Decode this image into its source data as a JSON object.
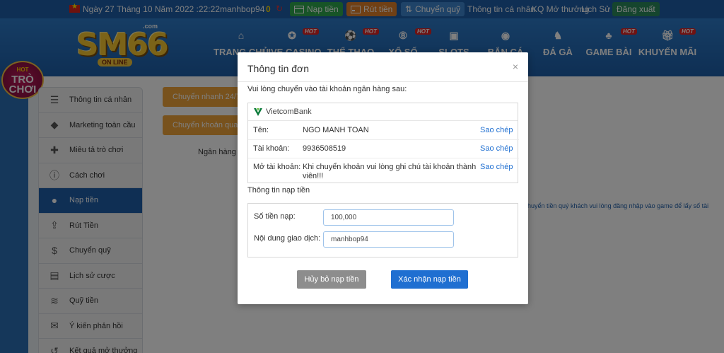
{
  "topbar": {
    "date": "Ngày 27 Tháng 10 Năm 2022 :22:22",
    "username": "manhbop94",
    "balance": "0",
    "deposit_label": "Nạp tiền",
    "withdraw_label": "Rút tiền",
    "transfer_label": "Chuyển quỹ",
    "links": [
      "Thông tin cá nhân",
      "KQ Mở thưởng",
      "Lịch Sử"
    ],
    "logout_label": "Đăng xuất"
  },
  "logo": {
    "text": "SM66",
    "com": ".com",
    "tagline": "ON LINE"
  },
  "nav": {
    "items": [
      {
        "label": "TRANG CHỦ",
        "icon": "home-icon",
        "hot": false
      },
      {
        "label": "LIVE CASINO",
        "icon": "casino-chip-icon",
        "hot": true
      },
      {
        "label": "THỂ THAO",
        "icon": "soccer-ball-icon",
        "hot": true
      },
      {
        "label": "XỔ SỐ",
        "icon": "lottery-ball-icon",
        "hot": true
      },
      {
        "label": "SLOTS",
        "icon": "slot-machine-icon",
        "hot": false
      },
      {
        "label": "BẮN CÁ",
        "icon": "fish-icon",
        "hot": false
      },
      {
        "label": "ĐÁ GÀ",
        "icon": "rooster-icon",
        "hot": false
      },
      {
        "label": "GAME BÀI",
        "icon": "cards-icon",
        "hot": true
      },
      {
        "label": "KHUYẾN MÃI",
        "icon": "gift-icon",
        "hot": true
      }
    ],
    "hot_label": "HOT"
  },
  "promo_badge": {
    "line1": "TRÒ",
    "line2": "CHƠI",
    "tag": "HOT"
  },
  "sidebar": {
    "items": [
      {
        "label": "Thông tin cá nhân",
        "icon": "id-card-icon"
      },
      {
        "label": "Marketing toàn cầu",
        "icon": "diamond-icon"
      },
      {
        "label": "Miêu tả trò chơi",
        "icon": "gamepad-icon"
      },
      {
        "label": "Cách chơi",
        "icon": "info-icon"
      },
      {
        "label": "Nạp tiền",
        "icon": "piggy-bank-icon",
        "active": true
      },
      {
        "label": "Rút Tiền",
        "icon": "withdraw-icon"
      },
      {
        "label": "Chuyển quỹ",
        "icon": "dollar-circle-icon"
      },
      {
        "label": "Lịch sử cược",
        "icon": "receipt-icon"
      },
      {
        "label": "Quỹ tiền",
        "icon": "coins-icon"
      },
      {
        "label": "Ý kiến phản hồi",
        "icon": "chat-icon"
      },
      {
        "label": "Kết quả mở thưởng",
        "icon": "history-icon"
      }
    ]
  },
  "background": {
    "tab1": "Chuyển nhanh 24/7",
    "tab2": "Chuyển khoản qua t",
    "bank_label": "Ngân hàng",
    "note": "huyển tiền quý khách vui lòng đăng nhập vào game để lấy số tài"
  },
  "modal": {
    "title": "Thông tin đơn",
    "close_glyph": "×",
    "instruction": "Vui lòng chuyển vào tài khoản ngân hàng sau:",
    "bank_name": "VietcomBank",
    "rows": [
      {
        "label": "Tên:",
        "value": "NGO MANH TOAN",
        "action": "Sao chép"
      },
      {
        "label": "Tài khoản:",
        "value": "9936508519",
        "action": "Sao chép"
      },
      {
        "label": "Mở tài khoản:",
        "value": "Khi chuyển khoản vui lòng ghi chú tài khoản thành viên!!!",
        "action": "Sao chép"
      }
    ],
    "deposit_section_label": "Thông tin nạp tiền",
    "amount_label": "Số tiền nạp:",
    "amount_value": "100,000",
    "content_label": "Nội dung giao dịch:",
    "content_value": "manhbop94",
    "cancel_label": "Hủy bỏ nạp tiền",
    "confirm_label": "Xác nhận nạp tiền"
  },
  "colors": {
    "brand_blue": "#1f5ea8",
    "link_blue": "#1f6fd1",
    "deposit_green": "#2fa84f",
    "withdraw_orange": "#e0812b",
    "tab_orange": "#f0a53a",
    "cancel_gray": "#8d8d8d"
  }
}
